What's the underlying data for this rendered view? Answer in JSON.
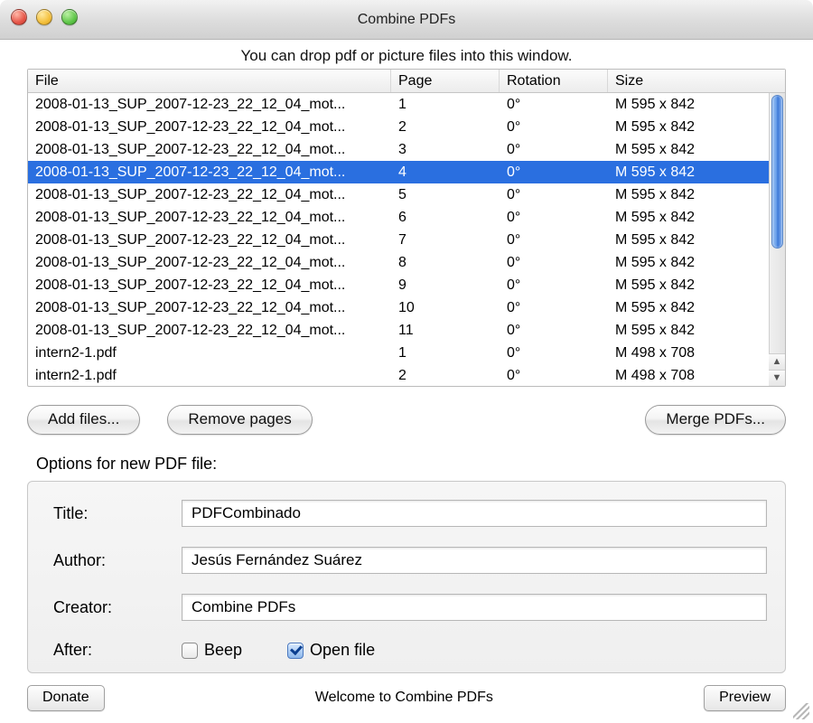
{
  "window": {
    "title": "Combine PDFs",
    "hint": "You can drop pdf or picture files into this window."
  },
  "table": {
    "headers": {
      "file": "File",
      "page": "Page",
      "rotation": "Rotation",
      "size": "Size"
    },
    "selected_index": 3,
    "rows": [
      {
        "file": "2008-01-13_SUP_2007-12-23_22_12_04_mot...",
        "page": "1",
        "rotation": "0°",
        "size": "M 595 x 842"
      },
      {
        "file": "2008-01-13_SUP_2007-12-23_22_12_04_mot...",
        "page": "2",
        "rotation": "0°",
        "size": "M 595 x 842"
      },
      {
        "file": "2008-01-13_SUP_2007-12-23_22_12_04_mot...",
        "page": "3",
        "rotation": "0°",
        "size": "M 595 x 842"
      },
      {
        "file": "2008-01-13_SUP_2007-12-23_22_12_04_mot...",
        "page": "4",
        "rotation": "0°",
        "size": "M 595 x 842"
      },
      {
        "file": "2008-01-13_SUP_2007-12-23_22_12_04_mot...",
        "page": "5",
        "rotation": "0°",
        "size": "M 595 x 842"
      },
      {
        "file": "2008-01-13_SUP_2007-12-23_22_12_04_mot...",
        "page": "6",
        "rotation": "0°",
        "size": "M 595 x 842"
      },
      {
        "file": "2008-01-13_SUP_2007-12-23_22_12_04_mot...",
        "page": "7",
        "rotation": "0°",
        "size": "M 595 x 842"
      },
      {
        "file": "2008-01-13_SUP_2007-12-23_22_12_04_mot...",
        "page": "8",
        "rotation": "0°",
        "size": "M 595 x 842"
      },
      {
        "file": "2008-01-13_SUP_2007-12-23_22_12_04_mot...",
        "page": "9",
        "rotation": "0°",
        "size": "M 595 x 842"
      },
      {
        "file": "2008-01-13_SUP_2007-12-23_22_12_04_mot...",
        "page": "10",
        "rotation": "0°",
        "size": "M 595 x 842"
      },
      {
        "file": "2008-01-13_SUP_2007-12-23_22_12_04_mot...",
        "page": "11",
        "rotation": "0°",
        "size": "M 595 x 842"
      },
      {
        "file": "intern2-1.pdf",
        "page": "1",
        "rotation": "0°",
        "size": "M 498 x 708"
      },
      {
        "file": "intern2-1.pdf",
        "page": "2",
        "rotation": "0°",
        "size": "M 498 x 708"
      }
    ]
  },
  "buttons": {
    "add": "Add files...",
    "remove": "Remove pages",
    "merge": "Merge PDFs...",
    "donate": "Donate",
    "preview": "Preview"
  },
  "options": {
    "group_label": "Options for new PDF file:",
    "title_label": "Title:",
    "title_value": "PDFCombinado",
    "author_label": "Author:",
    "author_value": "Jesús Fernández Suárez",
    "creator_label": "Creator:",
    "creator_value": "Combine PDFs",
    "after_label": "After:",
    "beep_label": "Beep",
    "beep_checked": false,
    "open_label": "Open file",
    "open_checked": true
  },
  "footer": {
    "welcome": "Welcome to Combine PDFs"
  }
}
